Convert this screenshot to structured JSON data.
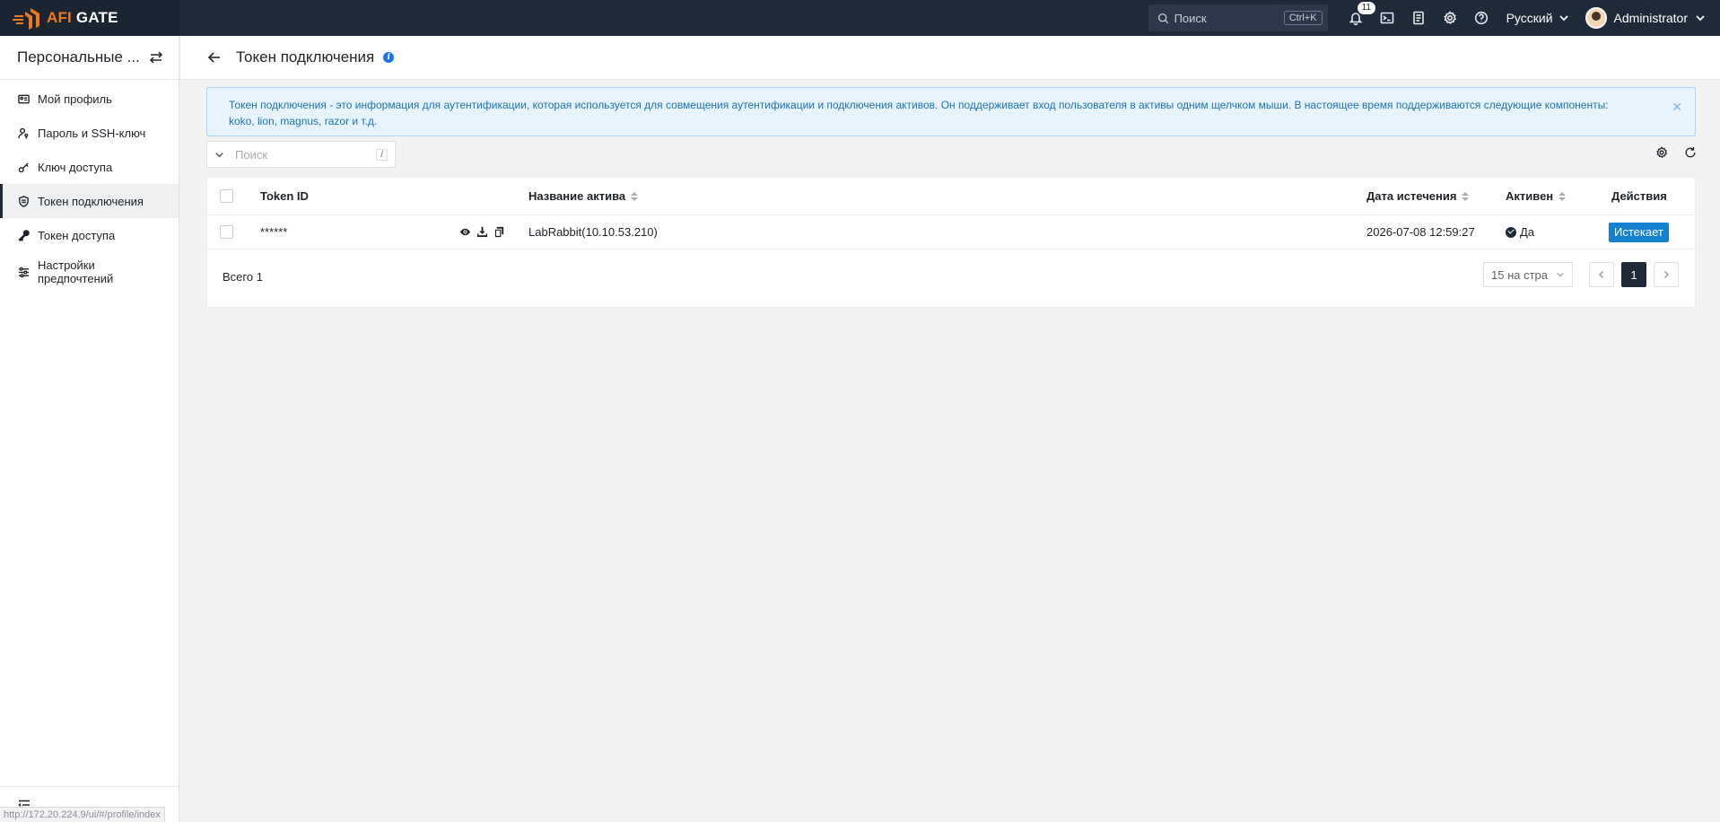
{
  "brand": {
    "name_prefix": "AFI",
    "name_suffix": " GATE"
  },
  "topbar": {
    "search_placeholder": "Поиск",
    "search_shortcut": "Ctrl+K",
    "notifications_count": "11",
    "language": "Русский",
    "user_name": "Administrator",
    "icons": [
      "bell-icon",
      "terminal-icon",
      "ticket-icon",
      "gear-icon",
      "help-icon"
    ]
  },
  "sidebar": {
    "title": "Персональные ...",
    "items": [
      {
        "label": "Мой профиль",
        "icon": "id-card-icon"
      },
      {
        "label": "Пароль и SSH-ключ",
        "icon": "user-key-icon"
      },
      {
        "label": "Ключ доступа",
        "icon": "key-icon"
      },
      {
        "label": "Токен подключения",
        "icon": "shield-icon",
        "active": true
      },
      {
        "label": "Токен доступа",
        "icon": "token-key-icon"
      },
      {
        "label": "Настройки предпочтений",
        "icon": "sliders-icon"
      }
    ]
  },
  "status_url": "http://172.20.224.9/ui/#/profile/index",
  "page": {
    "title": "Токен подключения",
    "alert": "Токен подключения - это информация для аутентификации, которая используется для совмещения аутентификации и подключения активов. Он поддерживает вход пользователя в активы одним щелчком мыши. В настоящее время поддерживаются следующие компоненты: koko, lion, magnus, razor и т.д.",
    "search_placeholder": "Поиск",
    "search_shortcut": "/"
  },
  "table": {
    "columns": {
      "token_id": "Token ID",
      "asset": "Название актива",
      "expires": "Дата истечения",
      "active": "Активен",
      "actions": "Действия"
    },
    "rows": [
      {
        "token_id": "******",
        "asset": "LabRabbit(10.10.53.210)",
        "expires": "2026-07-08 12:59:27",
        "active": "Да",
        "action_label": "Истекает"
      }
    ],
    "total_label": "Всего 1",
    "per_page": "15 на стра",
    "current_page": "1"
  },
  "colors": {
    "topbar": "#1f2a38",
    "brand_accent": "#f07a1a",
    "alert_bg": "#e8f4fd",
    "alert_text": "#1c72b8",
    "primary_button": "#1681d1"
  }
}
